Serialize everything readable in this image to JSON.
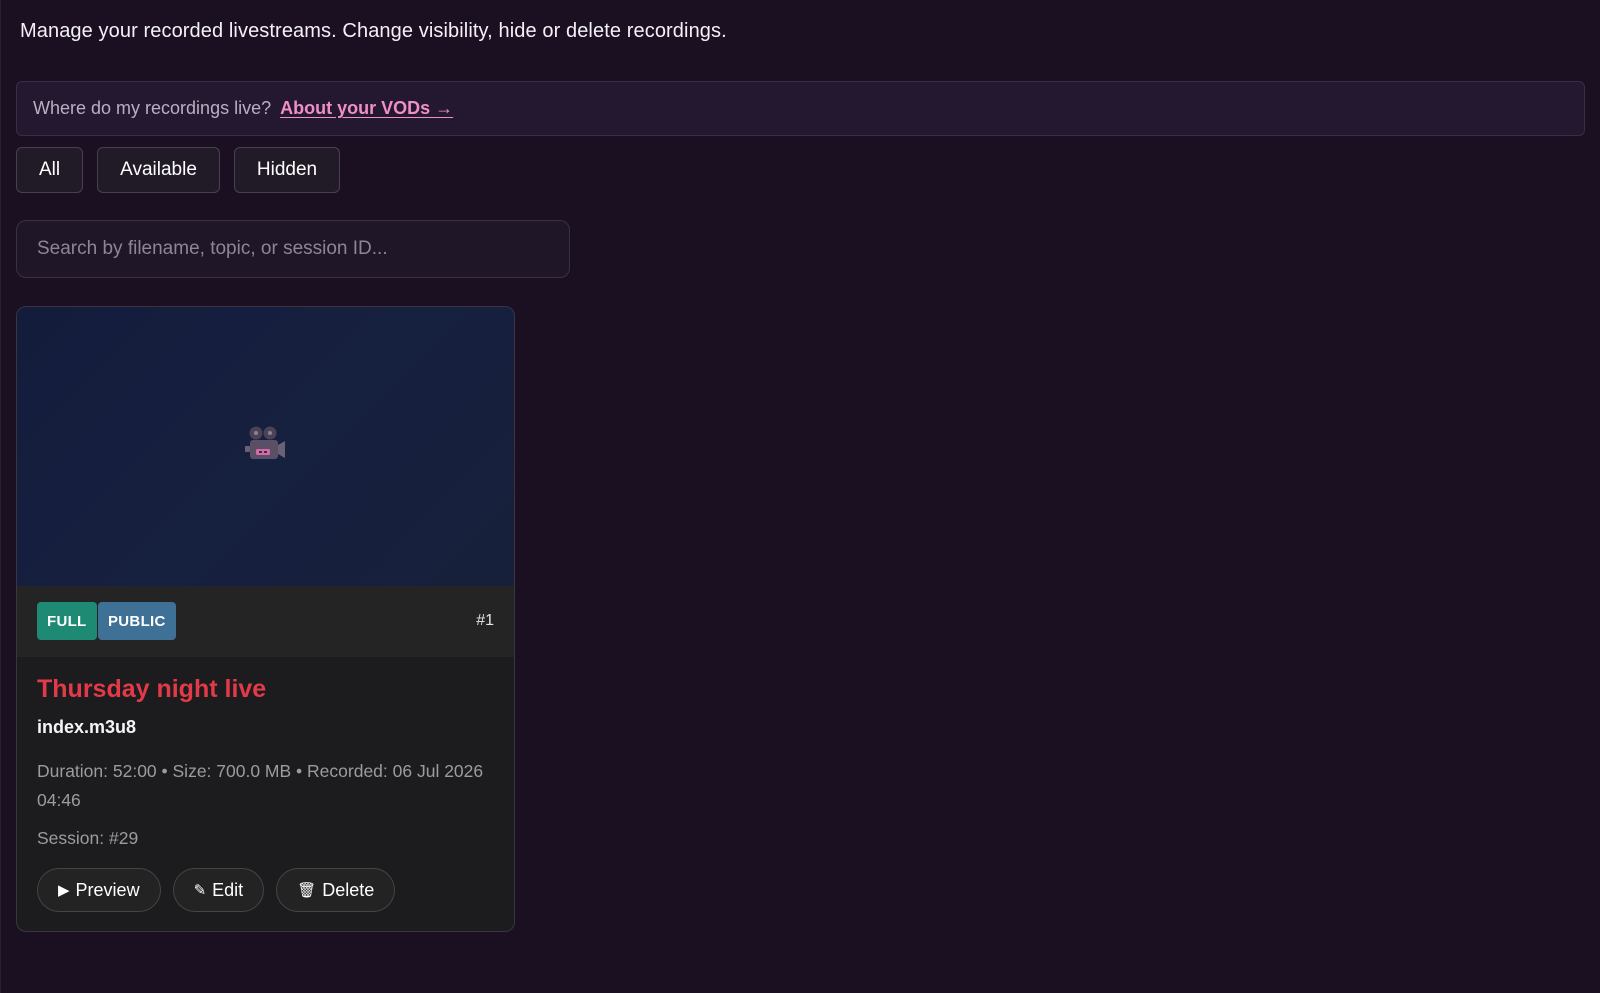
{
  "intro": {
    "text": "Manage your recorded livestreams. Change visibility, hide or delete recordings."
  },
  "info_bar": {
    "question": "Where do my recordings live?",
    "link_label": "About your VODs →"
  },
  "filters": [
    {
      "label": "All"
    },
    {
      "label": "Available"
    },
    {
      "label": "Hidden"
    }
  ],
  "search": {
    "placeholder": "Search by filename, topic, or session ID..."
  },
  "recordings": [
    {
      "badges": {
        "type": "FULL",
        "visibility": "PUBLIC"
      },
      "number": "#1",
      "title": "Thursday night live",
      "filename": "index.m3u8",
      "meta": "Duration: 52:00 • Size: 700.0 MB • Recorded: 06 Jul 2026 04:46",
      "session": "Session: #29",
      "thumbnail_icon": "movie-camera-icon",
      "actions": {
        "preview_icon": "▶",
        "preview_label": "Preview",
        "edit_icon": "✎",
        "edit_label": "Edit",
        "delete_icon": "🗑",
        "delete_label": "Delete"
      }
    }
  ],
  "colors": {
    "background": "#1b1022",
    "link": "#ef8fc8",
    "title": "#e23a48",
    "badge_full": "#1f8a73",
    "badge_public": "#3f7096"
  }
}
